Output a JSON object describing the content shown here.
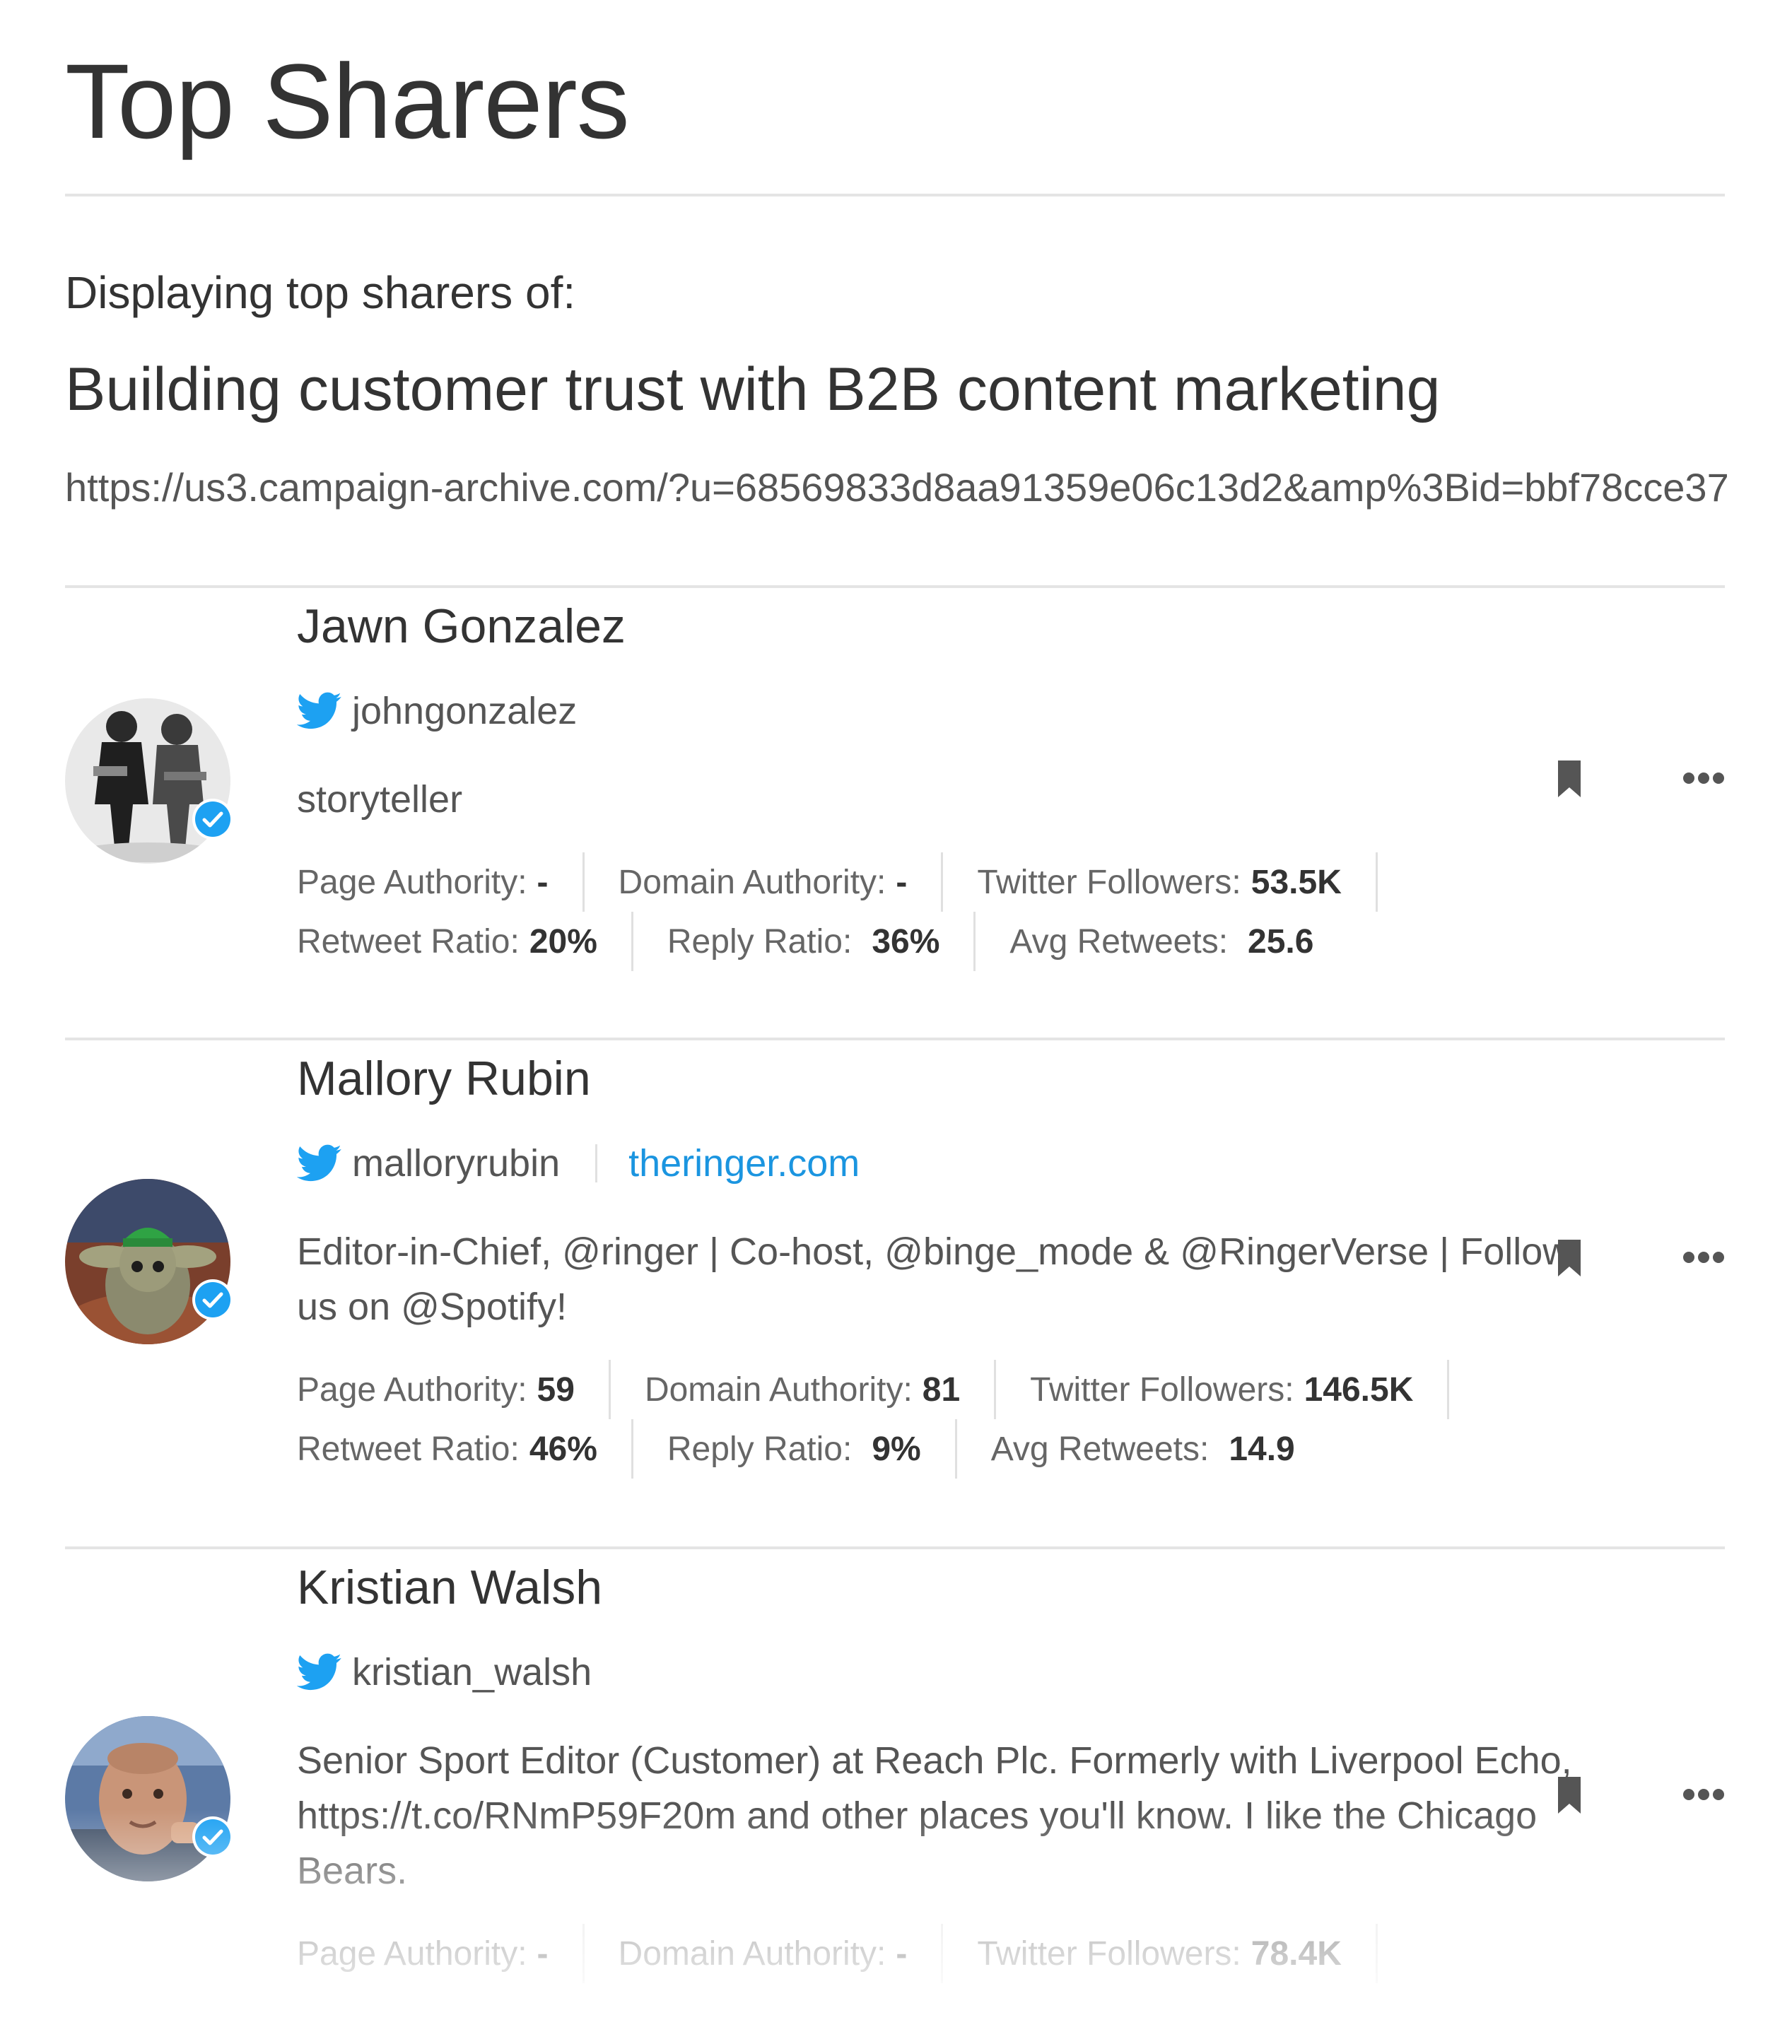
{
  "page": {
    "title": "Top Sharers",
    "context_label": "Displaying top sharers of:",
    "context_title": "Building customer trust with B2B content marketing",
    "context_url": "https://us3.campaign-archive.com/?u=68569833d8aa91359e06c13d2&amp%3Bid=bbf78cce37"
  },
  "stat_labels": {
    "page_authority": "Page Authority:",
    "domain_authority": "Domain Authority:",
    "twitter_followers": "Twitter Followers:",
    "retweet_ratio": "Retweet Ratio:",
    "reply_ratio": "Reply Ratio:",
    "avg_retweets": "Avg Retweets:"
  },
  "colors": {
    "accent": "#1b95e0",
    "twitter": "#1da1f2",
    "verified": "#1da1f2",
    "text": "#333333",
    "muted": "#666666",
    "divider": "#e4e4e4"
  },
  "sharers": [
    {
      "name": "Jawn Gonzalez",
      "handle": "johngonzalez",
      "website": "",
      "bio": "storyteller",
      "verified": true,
      "page_authority": "-",
      "domain_authority": "-",
      "twitter_followers": "53.5K",
      "retweet_ratio": "20%",
      "reply_ratio": "36%",
      "avg_retweets": "25.6"
    },
    {
      "name": "Mallory Rubin",
      "handle": "malloryrubin",
      "website": "theringer.com",
      "bio": "Editor-in-Chief, @ringer | Co-host, @binge_mode  & @RingerVerse | Follow us on @Spotify!",
      "verified": true,
      "page_authority": "59",
      "domain_authority": "81",
      "twitter_followers": "146.5K",
      "retweet_ratio": "46%",
      "reply_ratio": "9%",
      "avg_retweets": "14.9"
    },
    {
      "name": "Kristian Walsh",
      "handle": "kristian_walsh",
      "website": "",
      "bio": "Senior Sport Editor (Customer) at Reach Plc. Formerly with Liverpool Echo, https://t.co/RNmP59F20m and other places you'll know. I like the Chicago Bears.",
      "verified": true,
      "page_authority": "-",
      "domain_authority": "-",
      "twitter_followers": "78.4K",
      "retweet_ratio": "",
      "reply_ratio": "",
      "avg_retweets": ""
    }
  ],
  "icons": {
    "twitter": "twitter-bird-icon",
    "verified": "verified-check-icon",
    "bookmark": "bookmark-icon",
    "more": "more-horizontal-icon"
  }
}
